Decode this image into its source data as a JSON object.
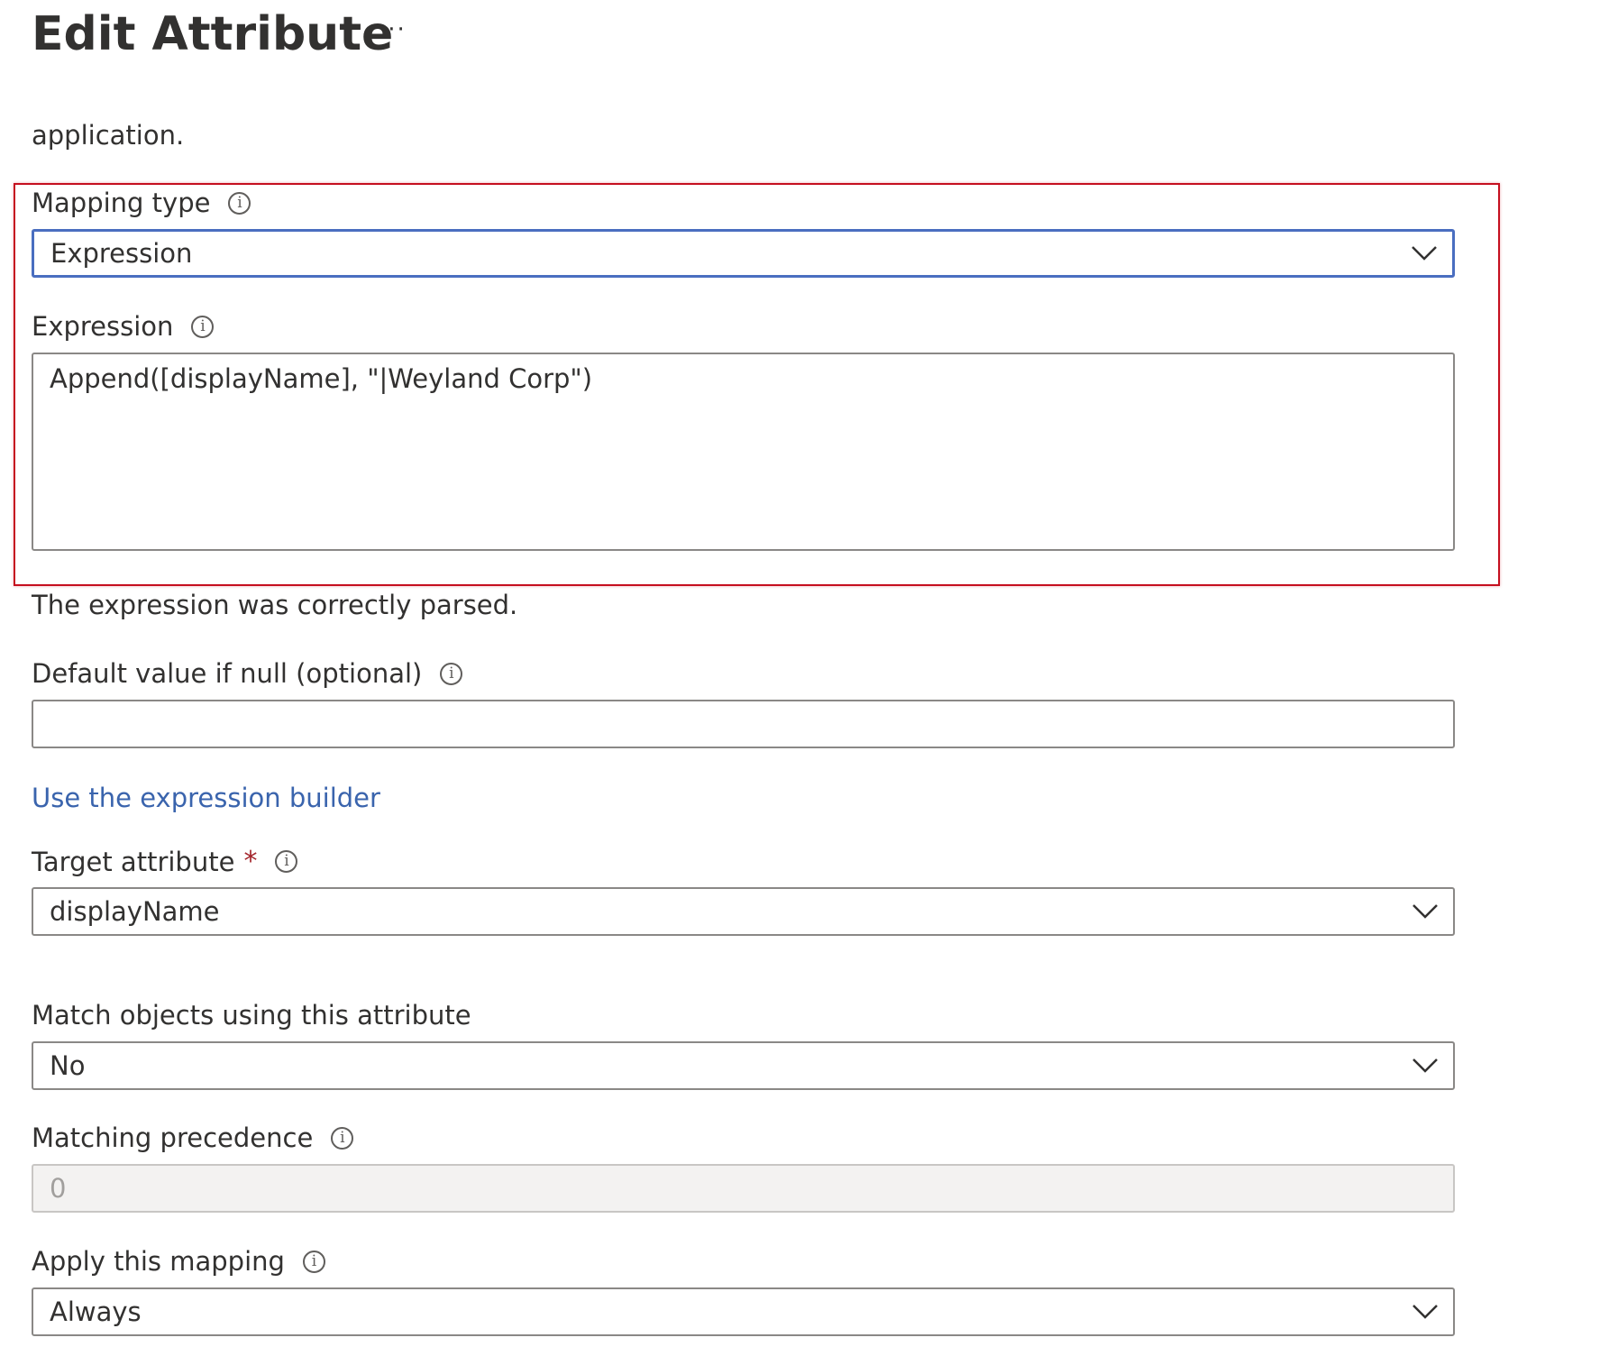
{
  "header": {
    "title": "Edit Attribute",
    "more_label": "···"
  },
  "description_tail": "application.",
  "mapping_type": {
    "label": "Mapping type",
    "value": "Expression"
  },
  "expression": {
    "label": "Expression",
    "value": "Append([displayName], \"|Weyland Corp\")"
  },
  "parse_status": "The expression was correctly parsed.",
  "default_value": {
    "label": "Default value if null (optional)",
    "value": ""
  },
  "expression_builder_link": "Use the expression builder",
  "target_attribute": {
    "label": "Target attribute",
    "required_mark": "*",
    "value": "displayName"
  },
  "match_objects": {
    "label": "Match objects using this attribute",
    "value": "No"
  },
  "matching_precedence": {
    "label": "Matching precedence",
    "value": "0"
  },
  "apply_mapping": {
    "label": "Apply this mapping",
    "value": "Always"
  },
  "icons": {
    "info": "info-icon",
    "chevron": "chevron-down-icon"
  },
  "colors": {
    "highlight_border": "#c50f1f",
    "focus_border": "#4a6ec0",
    "link": "#3a64ad",
    "required": "#a4262c"
  }
}
